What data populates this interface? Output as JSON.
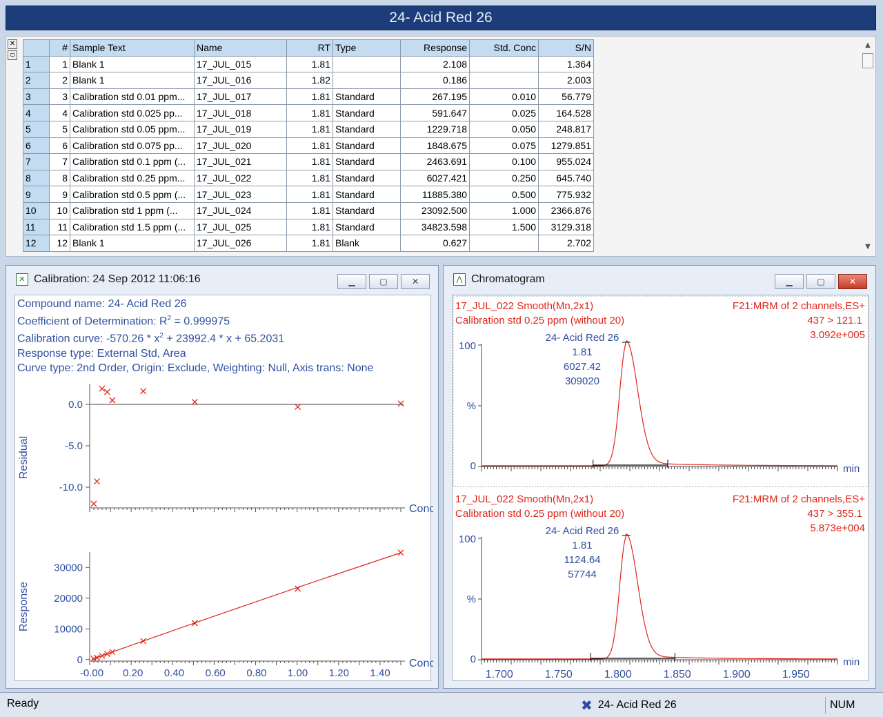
{
  "window": {
    "title": "24- Acid Red 26"
  },
  "table": {
    "columns": [
      "",
      "#",
      "Sample Text",
      "Name",
      "RT",
      "Type",
      "Response",
      "Std. Conc",
      "S/N"
    ],
    "rows": [
      [
        "1",
        "1",
        "Blank 1",
        "17_JUL_015",
        "1.81",
        "",
        "2.108",
        "",
        "1.364"
      ],
      [
        "2",
        "2",
        "Blank 1",
        "17_JUL_016",
        "1.82",
        "",
        "0.186",
        "",
        "2.003"
      ],
      [
        "3",
        "3",
        "Calibration std 0.01 ppm...",
        "17_JUL_017",
        "1.81",
        "Standard",
        "267.195",
        "0.010",
        "56.779"
      ],
      [
        "4",
        "4",
        "Calibration std 0.025 pp...",
        "17_JUL_018",
        "1.81",
        "Standard",
        "591.647",
        "0.025",
        "164.528"
      ],
      [
        "5",
        "5",
        "Calibration std 0.05 ppm...",
        "17_JUL_019",
        "1.81",
        "Standard",
        "1229.718",
        "0.050",
        "248.817"
      ],
      [
        "6",
        "6",
        "Calibration std 0.075 pp...",
        "17_JUL_020",
        "1.81",
        "Standard",
        "1848.675",
        "0.075",
        "1279.851"
      ],
      [
        "7",
        "7",
        "Calibration std 0.1 ppm (...",
        "17_JUL_021",
        "1.81",
        "Standard",
        "2463.691",
        "0.100",
        "955.024"
      ],
      [
        "8",
        "8",
        "Calibration std 0.25 ppm...",
        "17_JUL_022",
        "1.81",
        "Standard",
        "6027.421",
        "0.250",
        "645.740"
      ],
      [
        "9",
        "9",
        "Calibration std 0.5 ppm (...",
        "17_JUL_023",
        "1.81",
        "Standard",
        "11885.380",
        "0.500",
        "775.932"
      ],
      [
        "10",
        "10",
        "Calibration std 1 ppm (...",
        "17_JUL_024",
        "1.81",
        "Standard",
        "23092.500",
        "1.000",
        "2366.876"
      ],
      [
        "11",
        "11",
        "Calibration std 1.5 ppm (...",
        "17_JUL_025",
        "1.81",
        "Standard",
        "34823.598",
        "1.500",
        "3129.318"
      ],
      [
        "12",
        "12",
        "Blank 1",
        "17_JUL_026",
        "1.81",
        "Blank",
        "0.627",
        "",
        "2.702"
      ]
    ]
  },
  "calibration": {
    "title": "Calibration: 24 Sep 2012 11:06:16",
    "info": {
      "compound": "Compound name: 24- Acid Red 26",
      "coef_prefix": "Coefficient of Determination: R",
      "coef_sup": "2",
      "coef_suffix": " = 0.999975",
      "curve_prefix": "Calibration curve: -570.26 * x",
      "curve_sup": "2",
      "curve_suffix": " + 23992.4 * x + 65.2031",
      "response_type": "Response type: External Std, Area",
      "curve_type": "Curve type: 2nd Order, Origin: Exclude, Weighting: Null, Axis trans: None"
    }
  },
  "chromatogram": {
    "title": "Chromatogram",
    "traces": [
      {
        "sample": "17_JUL_022 Smooth(Mn,2x1)",
        "desc": "Calibration std 0.25 ppm (without 20)",
        "func": "F21:MRM of 2 channels,ES+",
        "transition": "437 > 121.1",
        "intensity": "3.092e+005",
        "peak_name": "24- Acid Red 26",
        "peak_rt": "1.81",
        "peak_area": "6027.42",
        "peak_height": "309020"
      },
      {
        "sample": "17_JUL_022 Smooth(Mn,2x1)",
        "desc": "Calibration std 0.25 ppm (without 20)",
        "func": "F21:MRM of 2 channels,ES+",
        "transition": "437 > 355.1",
        "intensity": "5.873e+004",
        "peak_name": "24- Acid Red 26",
        "peak_rt": "1.81",
        "peak_area": "1124.64",
        "peak_height": "57744"
      }
    ]
  },
  "status": {
    "ready": "Ready",
    "compound": "24- Acid Red 26",
    "num": "NUM"
  },
  "colors": {
    "accent": "#1c3d7a",
    "info_text": "#2f4fa0",
    "trace": "#e0261b",
    "grid_header": "#c4dcf1"
  },
  "chart_data": [
    {
      "type": "scatter",
      "title": "",
      "xlabel": "Conc",
      "ylabel": "Residual",
      "ylim": [
        -12,
        2.5
      ],
      "yticks": [
        "0.0",
        "-5.0",
        "-10.0"
      ],
      "points": [
        [
          0.01,
          -12
        ],
        [
          0.025,
          -9.3
        ],
        [
          0.05,
          1.9
        ],
        [
          0.075,
          1.5
        ],
        [
          0.1,
          0.5
        ],
        [
          0.25,
          1.6
        ],
        [
          0.5,
          0.3
        ],
        [
          1.0,
          -0.3
        ],
        [
          1.5,
          0.1
        ]
      ]
    },
    {
      "type": "line",
      "title": "",
      "xlabel": "Conc",
      "ylabel": "Response",
      "xlim": [
        -0.01,
        1.5
      ],
      "ylim": [
        -500,
        35000
      ],
      "xticks": [
        "-0.00",
        "0.20",
        "0.40",
        "0.60",
        "0.80",
        "1.00",
        "1.20",
        "1.40"
      ],
      "yticks": [
        "0",
        "10000",
        "20000",
        "30000"
      ],
      "points": [
        [
          0.01,
          267.195
        ],
        [
          0.025,
          591.647
        ],
        [
          0.05,
          1229.718
        ],
        [
          0.075,
          1848.675
        ],
        [
          0.1,
          2463.691
        ],
        [
          0.25,
          6027.421
        ],
        [
          0.5,
          11885.38
        ],
        [
          1.0,
          23092.5
        ],
        [
          1.5,
          34823.598
        ]
      ],
      "curve": {
        "a": -570.26,
        "b": 23992.4,
        "c": 65.2031
      }
    },
    {
      "type": "line",
      "title": "",
      "xlabel": "min",
      "ylabel": "%",
      "xlim": [
        1.685,
        1.985
      ],
      "ylim": [
        0,
        100
      ],
      "yticks": [
        "100",
        "0"
      ],
      "peak": {
        "center": 1.807,
        "sigma_left": 0.0055,
        "sigma_right": 0.0095,
        "max": 100,
        "tail": 3
      },
      "baseline": [
        1.779,
        1.842
      ]
    },
    {
      "type": "line",
      "title": "",
      "xlabel": "min",
      "ylabel": "%",
      "xlim": [
        1.685,
        1.985
      ],
      "ylim": [
        0,
        100
      ],
      "xticks": [
        "1.700",
        "1.750",
        "1.800",
        "1.850",
        "1.900",
        "1.950"
      ],
      "yticks": [
        "100",
        "0"
      ],
      "peak": {
        "center": 1.807,
        "sigma_left": 0.0055,
        "sigma_right": 0.0095,
        "max": 100,
        "tail": 3
      },
      "baseline": [
        1.777,
        1.848
      ]
    }
  ]
}
